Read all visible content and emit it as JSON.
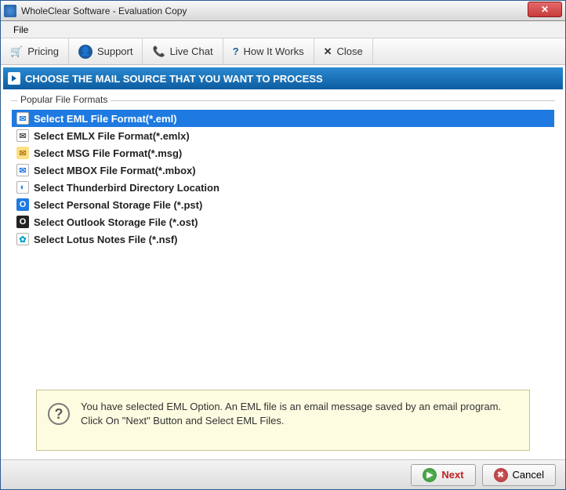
{
  "window": {
    "title": "WholeClear Software - Evaluation Copy"
  },
  "menubar": {
    "file": "File"
  },
  "toolbar": {
    "pricing": "Pricing",
    "support": "Support",
    "livechat": "Live Chat",
    "howitworks": "How It Works",
    "close": "Close"
  },
  "banner": {
    "text": "CHOOSE THE MAIL SOURCE THAT YOU WANT TO PROCESS"
  },
  "formats": {
    "group_label": "Popular File Formats",
    "items": [
      {
        "label": "Select EML File Format(*.eml)",
        "icon_bg": "#ffffff",
        "icon_fg": "#1e7ae0",
        "glyph": "✉",
        "selected": true
      },
      {
        "label": "Select EMLX File Format(*.emlx)",
        "icon_bg": "#ffffff",
        "icon_fg": "#555555",
        "glyph": "✉",
        "selected": false
      },
      {
        "label": "Select MSG File Format(*.msg)",
        "icon_bg": "#ffe08a",
        "icon_fg": "#b07a10",
        "glyph": "✉",
        "selected": false
      },
      {
        "label": "Select MBOX File Format(*.mbox)",
        "icon_bg": "#ffffff",
        "icon_fg": "#1e7ae0",
        "glyph": "✉",
        "selected": false
      },
      {
        "label": "Select Thunderbird Directory Location",
        "icon_bg": "#ffffff",
        "icon_fg": "#1e7ae0",
        "glyph": "◐",
        "selected": false
      },
      {
        "label": "Select Personal Storage File (*.pst)",
        "icon_bg": "#1e7ae0",
        "icon_fg": "#ffffff",
        "glyph": "O",
        "selected": false
      },
      {
        "label": "Select Outlook Storage File (*.ost)",
        "icon_bg": "#222222",
        "icon_fg": "#ffffff",
        "glyph": "O",
        "selected": false
      },
      {
        "label": "Select Lotus Notes File (*.nsf)",
        "icon_bg": "#ffffff",
        "icon_fg": "#00a0c8",
        "glyph": "✿",
        "selected": false
      }
    ]
  },
  "info": {
    "text": "You have selected EML Option. An EML file is an email message saved by an email program. Click On \"Next\" Button and Select EML Files."
  },
  "footer": {
    "next": "Next",
    "cancel": "Cancel"
  }
}
